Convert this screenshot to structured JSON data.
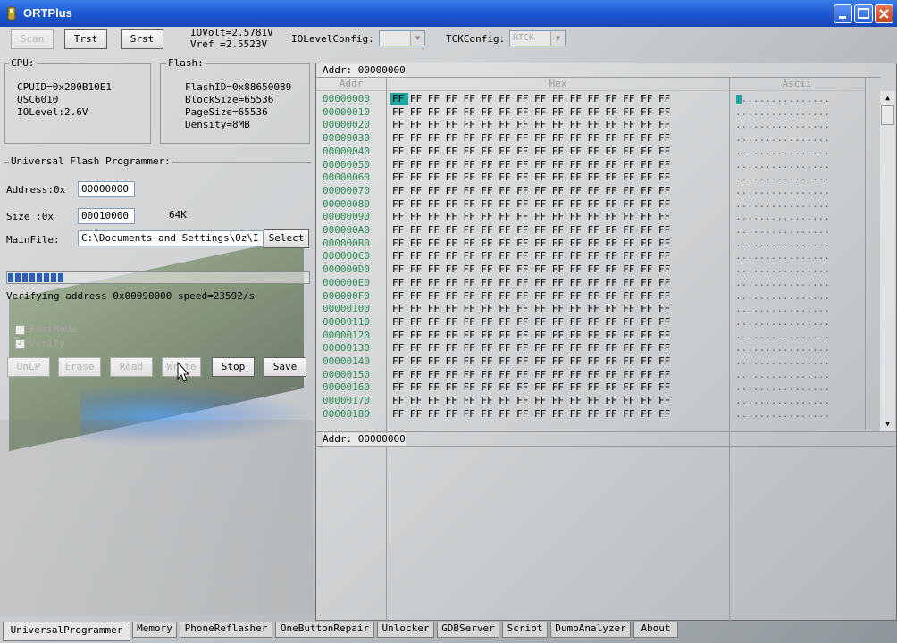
{
  "window": {
    "title": "ORTPlus",
    "colors": {
      "titlebar": "#1d58d3",
      "hex_cursor": "#1ca7a0",
      "addr_text": "#2e8b57",
      "progress": "#2f5fb8"
    }
  },
  "toolbar": {
    "scan": "Scan",
    "trst": "Trst",
    "srst": "Srst",
    "iovolt": "IOVolt=2.5781V",
    "vref": "Vref  =2.5523V",
    "iolevel_label": "IOLevelConfig:",
    "iolevel_value": "",
    "tck_label": "TCKConfig:",
    "tck_value": "RTCK"
  },
  "cpu": {
    "legend": "CPU:",
    "cpuid": "CPUID=0x200B10E1",
    "chip": "QSC6010",
    "iolevel": "IOLevel:2.6V"
  },
  "flash": {
    "legend": "Flash:",
    "flashid": "FlashID=0x88650089",
    "blocksize": "BlockSize=65536",
    "pagesize": "PageSize=65536",
    "density": "Density=8MB"
  },
  "programmer": {
    "title": "Universal Flash Programmer:",
    "address_label": "Address:0x",
    "address_value": "00000000",
    "size_label": "Size   :0x",
    "size_value": "00010000",
    "size_human": "64K",
    "mainfile_label": "MainFile:",
    "mainfile_value": "C:\\Documents and Settings\\Oz\\I",
    "select": "Select",
    "progress": 0.2,
    "status": "Verifying address 0x00090000 speed=23592/s",
    "fastmode": "FastMode",
    "verify": "Verify",
    "buttons": {
      "unlp": "UnLP",
      "erase": "Erase",
      "read": "Read",
      "write": "Write",
      "stop": "Stop",
      "save": "Save"
    }
  },
  "hex": {
    "top_addr_label": "Addr: 00000000",
    "bottom_addr_label": "Addr: 00000000",
    "col_addr": "Addr",
    "col_hex": "Hex",
    "col_ascii": "Ascii",
    "rows": [
      {
        "addr": "00000000",
        "bytes": "FF FF FF FF FF FF FF FF FF FF FF FF FF FF FF FF",
        "ascii": "................"
      },
      {
        "addr": "00000010",
        "bytes": "FF FF FF FF FF FF FF FF FF FF FF FF FF FF FF FF",
        "ascii": "................"
      },
      {
        "addr": "00000020",
        "bytes": "FF FF FF FF FF FF FF FF FF FF FF FF FF FF FF FF",
        "ascii": "................"
      },
      {
        "addr": "00000030",
        "bytes": "FF FF FF FF FF FF FF FF FF FF FF FF FF FF FF FF",
        "ascii": "................"
      },
      {
        "addr": "00000040",
        "bytes": "FF FF FF FF FF FF FF FF FF FF FF FF FF FF FF FF",
        "ascii": "................"
      },
      {
        "addr": "00000050",
        "bytes": "FF FF FF FF FF FF FF FF FF FF FF FF FF FF FF FF",
        "ascii": "................"
      },
      {
        "addr": "00000060",
        "bytes": "FF FF FF FF FF FF FF FF FF FF FF FF FF FF FF FF",
        "ascii": "................"
      },
      {
        "addr": "00000070",
        "bytes": "FF FF FF FF FF FF FF FF FF FF FF FF FF FF FF FF",
        "ascii": "................"
      },
      {
        "addr": "00000080",
        "bytes": "FF FF FF FF FF FF FF FF FF FF FF FF FF FF FF FF",
        "ascii": "................"
      },
      {
        "addr": "00000090",
        "bytes": "FF FF FF FF FF FF FF FF FF FF FF FF FF FF FF FF",
        "ascii": "................"
      },
      {
        "addr": "000000A0",
        "bytes": "FF FF FF FF FF FF FF FF FF FF FF FF FF FF FF FF",
        "ascii": "................"
      },
      {
        "addr": "000000B0",
        "bytes": "FF FF FF FF FF FF FF FF FF FF FF FF FF FF FF FF",
        "ascii": "................"
      },
      {
        "addr": "000000C0",
        "bytes": "FF FF FF FF FF FF FF FF FF FF FF FF FF FF FF FF",
        "ascii": "................"
      },
      {
        "addr": "000000D0",
        "bytes": "FF FF FF FF FF FF FF FF FF FF FF FF FF FF FF FF",
        "ascii": "................"
      },
      {
        "addr": "000000E0",
        "bytes": "FF FF FF FF FF FF FF FF FF FF FF FF FF FF FF FF",
        "ascii": "................"
      },
      {
        "addr": "000000F0",
        "bytes": "FF FF FF FF FF FF FF FF FF FF FF FF FF FF FF FF",
        "ascii": "................"
      },
      {
        "addr": "00000100",
        "bytes": "FF FF FF FF FF FF FF FF FF FF FF FF FF FF FF FF",
        "ascii": "................"
      },
      {
        "addr": "00000110",
        "bytes": "FF FF FF FF FF FF FF FF FF FF FF FF FF FF FF FF",
        "ascii": "................"
      },
      {
        "addr": "00000120",
        "bytes": "FF FF FF FF FF FF FF FF FF FF FF FF FF FF FF FF",
        "ascii": "................"
      },
      {
        "addr": "00000130",
        "bytes": "FF FF FF FF FF FF FF FF FF FF FF FF FF FF FF FF",
        "ascii": "................"
      },
      {
        "addr": "00000140",
        "bytes": "FF FF FF FF FF FF FF FF FF FF FF FF FF FF FF FF",
        "ascii": "................"
      },
      {
        "addr": "00000150",
        "bytes": "FF FF FF FF FF FF FF FF FF FF FF FF FF FF FF FF",
        "ascii": "................"
      },
      {
        "addr": "00000160",
        "bytes": "FF FF FF FF FF FF FF FF FF FF FF FF FF FF FF FF",
        "ascii": "................"
      },
      {
        "addr": "00000170",
        "bytes": "FF FF FF FF FF FF FF FF FF FF FF FF FF FF FF FF",
        "ascii": "................"
      },
      {
        "addr": "00000180",
        "bytes": "FF FF FF FF FF FF FF FF FF FF FF FF FF FF FF FF",
        "ascii": "................"
      }
    ]
  },
  "tabs": [
    "UniversalProgrammer",
    "Memory",
    "PhoneReflasher",
    "OneButtonRepair",
    "Unlocker",
    "GDBServer",
    "Script",
    "DumpAnalyzer",
    "About"
  ]
}
